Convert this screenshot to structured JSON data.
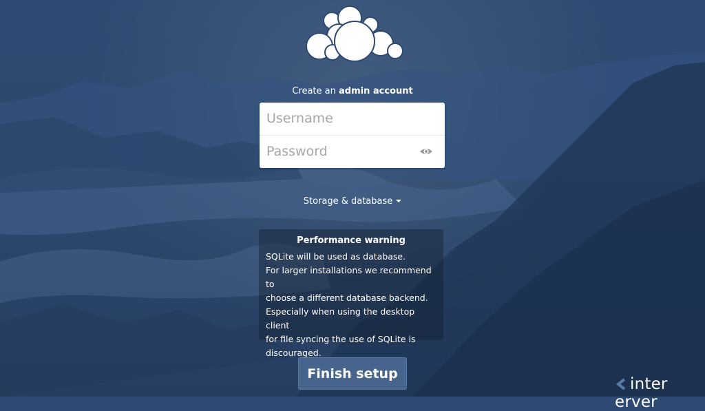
{
  "header": {
    "title_prefix": "Create an ",
    "title_bold": "admin account"
  },
  "form": {
    "username_placeholder": "Username",
    "password_placeholder": "Password"
  },
  "storage": {
    "label": "Storage & database"
  },
  "warning": {
    "heading": "Performance warning",
    "lines": [
      "SQLite will be used as database.",
      "For larger installations we recommend to",
      "choose a different database backend.",
      "Especially when using the desktop client",
      "for file syncing the use of SQLite is",
      "discouraged."
    ]
  },
  "actions": {
    "finish_label": "Finish setup"
  },
  "watermark": {
    "text_1": "inter",
    "text_2": "erver"
  },
  "icons": {
    "logo": "cloud-logo-icon",
    "eye": "eye-icon",
    "caret": "caret-down-icon"
  },
  "colors": {
    "background": "#2f4a72",
    "button": "#47648c",
    "text": "#ffffff"
  }
}
